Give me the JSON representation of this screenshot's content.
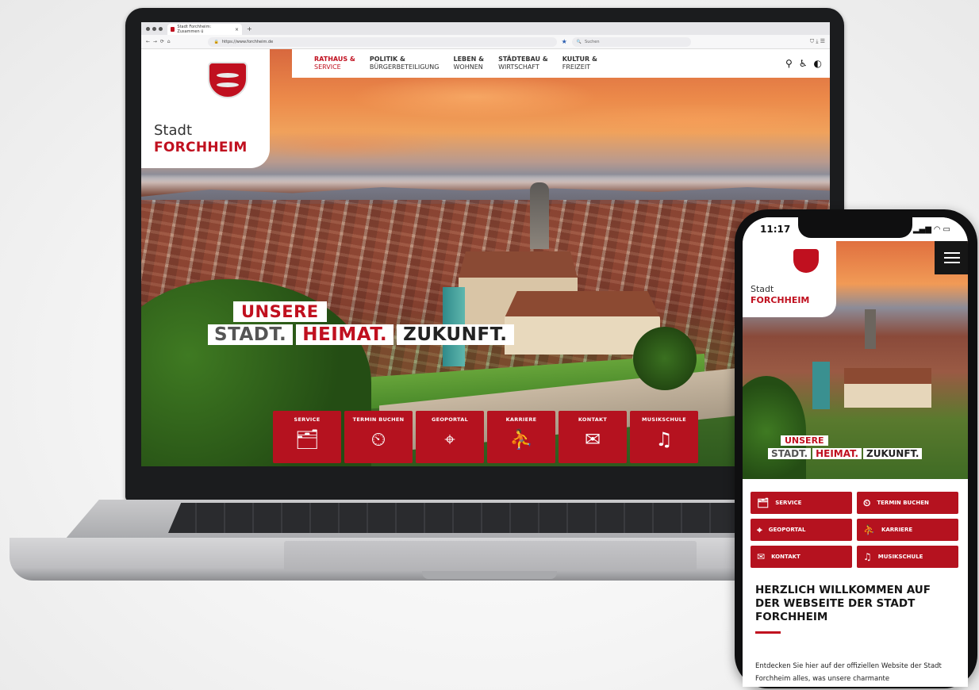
{
  "browser": {
    "tab_title": "Stadt Forchheim: Zusammen ü",
    "tab_close": "×",
    "new_tab": "+",
    "url": "https://www.forchheim.de",
    "search_placeholder": "Suchen"
  },
  "site": {
    "logo_line1": "Stadt",
    "logo_line2": "FORCHHEIM",
    "nav": [
      {
        "line1": "RATHAUS &",
        "line2": "SERVICE"
      },
      {
        "line1": "POLITIK &",
        "line2": "BÜRGERBETEILIGUNG"
      },
      {
        "line1": "LEBEN &",
        "line2": "WOHNEN"
      },
      {
        "line1": "STÄDTEBAU &",
        "line2": "WIRTSCHAFT"
      },
      {
        "line1": "KULTUR &",
        "line2": "FREIZEIT"
      }
    ],
    "tools": {
      "search_icon": "search-icon",
      "accessibility_icon": "accessibility-icon",
      "contrast_icon": "contrast-icon"
    },
    "slogan": {
      "top": "UNSERE",
      "words": [
        "STADT.",
        "HEIMAT.",
        "ZUKUNFT."
      ]
    },
    "quick_links": [
      {
        "label": "SERVICE",
        "icon": "folder-az-icon"
      },
      {
        "label": "TERMIN BUCHEN",
        "icon": "person-clock-icon"
      },
      {
        "label": "GEOPORTAL",
        "icon": "map-pin-icon"
      },
      {
        "label": "KARRIERE",
        "icon": "career-stairs-icon"
      },
      {
        "label": "KONTAKT",
        "icon": "envelope-at-icon"
      },
      {
        "label": "MUSIKSCHULE",
        "icon": "instruments-icon"
      }
    ]
  },
  "phone": {
    "time": "11:17",
    "welcome_title": "HERZLICH WILLKOMMEN AUF DER WEBSEITE DER STADT FORCHHEIM",
    "welcome_text": "Entdecken Sie hier auf der offiziellen Website der Stadt Forchheim alles, was unsere charmante"
  },
  "colors": {
    "brand_red": "#c0101f",
    "tile_red": "#b5121f"
  }
}
